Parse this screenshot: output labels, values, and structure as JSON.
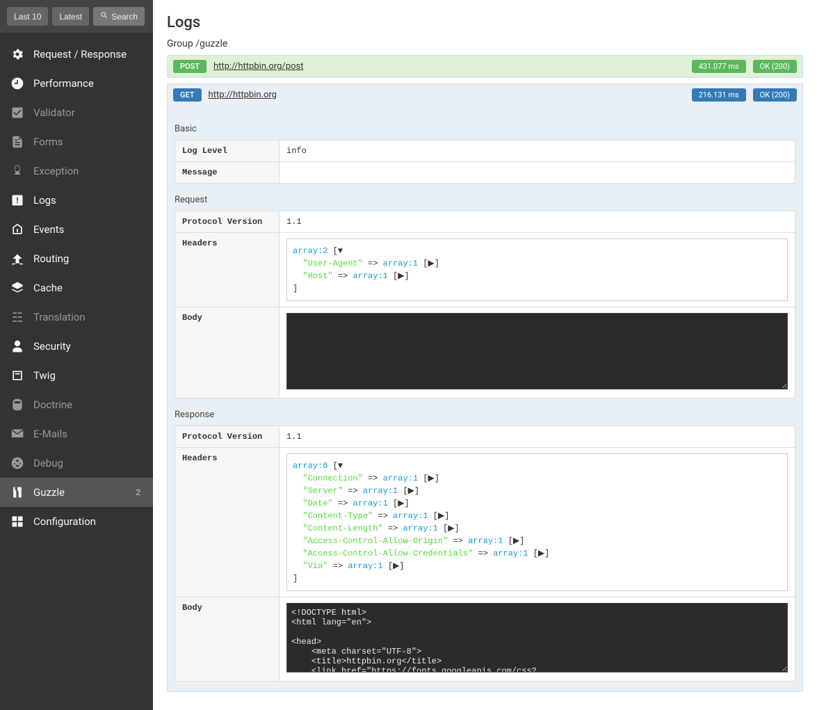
{
  "topbar": {
    "last10": "Last 10",
    "latest": "Latest",
    "search": "Search"
  },
  "sidebar": {
    "items": [
      {
        "label": "Request / Response",
        "dim": false
      },
      {
        "label": "Performance",
        "dim": false
      },
      {
        "label": "Validator",
        "dim": true
      },
      {
        "label": "Forms",
        "dim": true
      },
      {
        "label": "Exception",
        "dim": true
      },
      {
        "label": "Logs",
        "dim": false
      },
      {
        "label": "Events",
        "dim": false
      },
      {
        "label": "Routing",
        "dim": false
      },
      {
        "label": "Cache",
        "dim": false
      },
      {
        "label": "Translation",
        "dim": true
      },
      {
        "label": "Security",
        "dim": false
      },
      {
        "label": "Twig",
        "dim": false
      },
      {
        "label": "Doctrine",
        "dim": true
      },
      {
        "label": "E-Mails",
        "dim": true
      },
      {
        "label": "Debug",
        "dim": true
      },
      {
        "label": "Guzzle",
        "dim": false,
        "count": "2",
        "active": true
      },
      {
        "label": "Configuration",
        "dim": false
      }
    ]
  },
  "page": {
    "title": "Logs",
    "group_label": "Group",
    "group_path": "/guzzle"
  },
  "entries": [
    {
      "method": "POST",
      "method_class": "method-post",
      "url": "http://httpbin.org/post",
      "time": "431.077 ms",
      "status": "OK (200)",
      "theme": "green",
      "expanded": false
    },
    {
      "method": "GET",
      "method_class": "method-get",
      "url": "http://httpbin.org",
      "time": "216.131 ms",
      "status": "OK (200)",
      "theme": "blue",
      "expanded": true,
      "basic": {
        "title": "Basic",
        "log_level_label": "Log Level",
        "log_level": "info",
        "message_label": "Message",
        "message": ""
      },
      "request": {
        "title": "Request",
        "protocol_label": "Protocol Version",
        "protocol": "1.1",
        "headers_label": "Headers",
        "headers_count": "array:2",
        "headers": [
          {
            "key": "\"User-Agent\"",
            "val": "array:1"
          },
          {
            "key": "\"Host\"",
            "val": "array:1"
          }
        ],
        "body_label": "Body",
        "body": ""
      },
      "response": {
        "title": "Response",
        "protocol_label": "Protocol Version",
        "protocol": "1.1",
        "headers_label": "Headers",
        "headers_count": "array:8",
        "headers": [
          {
            "key": "\"Connection\"",
            "val": "array:1"
          },
          {
            "key": "\"Server\"",
            "val": "array:1"
          },
          {
            "key": "\"Date\"",
            "val": "array:1"
          },
          {
            "key": "\"Content-Type\"",
            "val": "array:1"
          },
          {
            "key": "\"Content-Length\"",
            "val": "array:1"
          },
          {
            "key": "\"Access-Control-Allow-Origin\"",
            "val": "array:1"
          },
          {
            "key": "\"Access-Control-Allow-Credentials\"",
            "val": "array:1"
          },
          {
            "key": "\"Via\"",
            "val": "array:1"
          }
        ],
        "body_label": "Body",
        "body": "<!DOCTYPE html>\n<html lang=\"en\">\n\n<head>\n    <meta charset=\"UTF-8\">\n    <title>httpbin.org</title>\n    <link href=\"https://fonts.googleapis.com/css?"
      }
    }
  ]
}
